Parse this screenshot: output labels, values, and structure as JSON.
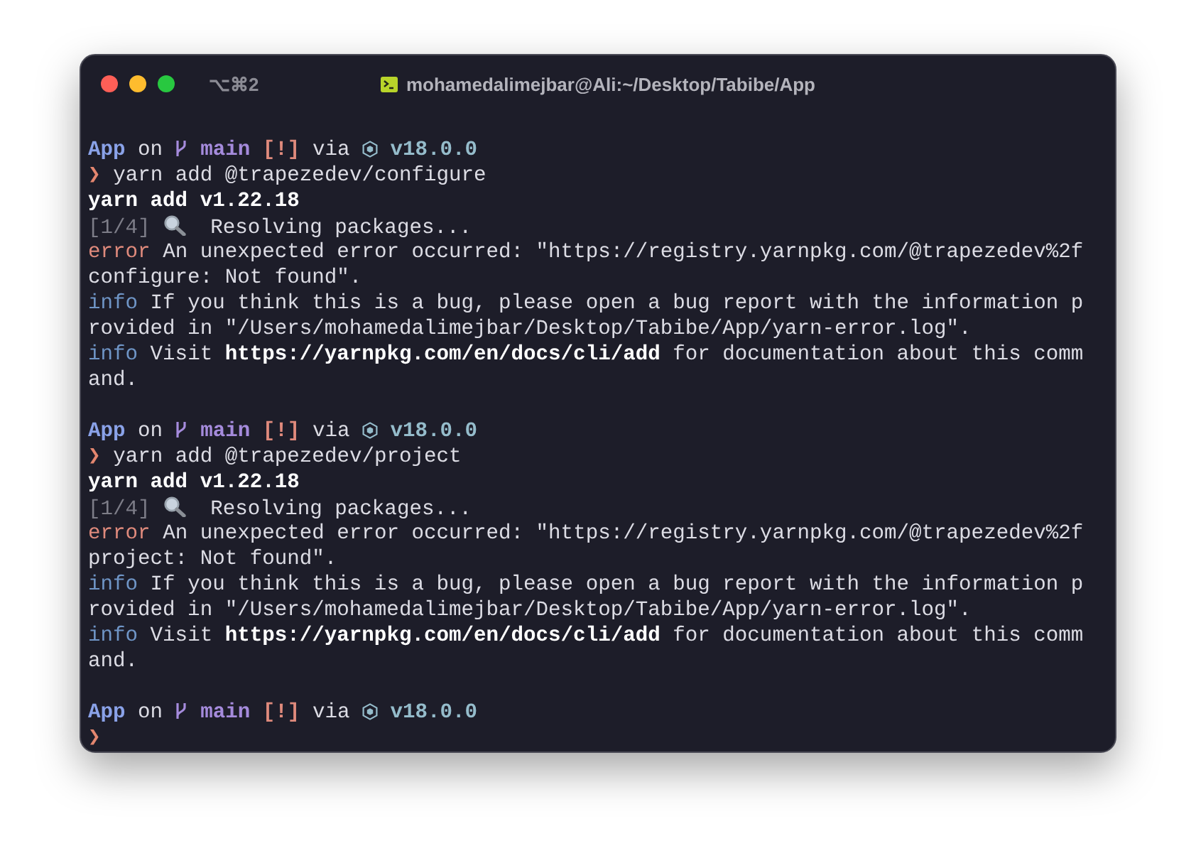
{
  "window": {
    "shortcut": "⌥⌘2",
    "title": "mohamedalimejbar@Ali:~/Desktop/Tabibe/App"
  },
  "lines": [
    {
      "kind": "blank"
    },
    {
      "kind": "prompt",
      "dir": "App",
      "on": "on",
      "branch": "main",
      "status": "[!]",
      "via": "via",
      "version": "v18.0.0"
    },
    {
      "kind": "command",
      "arrow": "❯",
      "text": "yarn add @trapezedev/configure"
    },
    {
      "kind": "heading",
      "text": "yarn add v1.22.18"
    },
    {
      "kind": "step",
      "step": "[1/4]",
      "text": "Resolving packages..."
    },
    {
      "kind": "log",
      "tag": "error",
      "color": "#df8a7c",
      "text": "An unexpected error occurred: \"https://registry.yarnpkg.com/@trapezedev%2f"
    },
    {
      "kind": "plain",
      "text": "configure: Not found\"."
    },
    {
      "kind": "log",
      "tag": "info",
      "color": "#6f95c6",
      "text": "If you think this is a bug, please open a bug report with the information p"
    },
    {
      "kind": "plain",
      "text": "rovided in \"/Users/mohamedalimejbar/Desktop/Tabibe/App/yarn-error.log\"."
    },
    {
      "kind": "log",
      "tag": "info",
      "color": "#6f95c6",
      "text": "Visit **https://yarnpkg.com/en/docs/cli/add** for documentation about this comm"
    },
    {
      "kind": "plain",
      "text": "and."
    },
    {
      "kind": "blank"
    },
    {
      "kind": "prompt",
      "dir": "App",
      "on": "on",
      "branch": "main",
      "status": "[!]",
      "via": "via",
      "version": "v18.0.0"
    },
    {
      "kind": "command",
      "arrow": "❯",
      "text": "yarn add @trapezedev/project"
    },
    {
      "kind": "heading",
      "text": "yarn add v1.22.18"
    },
    {
      "kind": "step",
      "step": "[1/4]",
      "text": "Resolving packages..."
    },
    {
      "kind": "log",
      "tag": "error",
      "color": "#df8a7c",
      "text": "An unexpected error occurred: \"https://registry.yarnpkg.com/@trapezedev%2f"
    },
    {
      "kind": "plain",
      "text": "project: Not found\"."
    },
    {
      "kind": "log",
      "tag": "info",
      "color": "#6f95c6",
      "text": "If you think this is a bug, please open a bug report with the information p"
    },
    {
      "kind": "plain",
      "text": "rovided in \"/Users/mohamedalimejbar/Desktop/Tabibe/App/yarn-error.log\"."
    },
    {
      "kind": "log",
      "tag": "info",
      "color": "#6f95c6",
      "text": "Visit **https://yarnpkg.com/en/docs/cli/add** for documentation about this comm"
    },
    {
      "kind": "plain",
      "text": "and."
    },
    {
      "kind": "blank"
    },
    {
      "kind": "prompt",
      "dir": "App",
      "on": "on",
      "branch": "main",
      "status": "[!]",
      "via": "via",
      "version": "v18.0.0"
    },
    {
      "kind": "command",
      "arrow": "❯"
    }
  ]
}
